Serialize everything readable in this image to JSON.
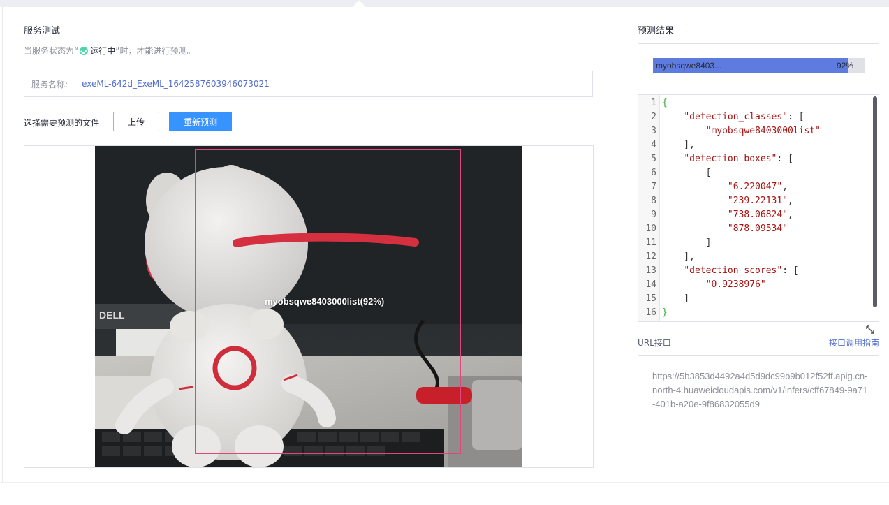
{
  "service_test": {
    "title": "服务测试",
    "status_note": {
      "prefix": "当服务状态为“",
      "status": "运行中",
      "suffix": "”时，才能进行预测。"
    },
    "service_name_label": "服务名称:",
    "service_name_value": "exeML-642d_ExeML_1642587603946073021",
    "select_file_label": "选择需要预测的文件",
    "upload_button": "上传",
    "repredict_button": "重新预测",
    "detection_label": "myobsqwe8403000list(92%)"
  },
  "prediction": {
    "title": "预测结果",
    "bar": {
      "label": "myobsqwe8403...",
      "percent_text": "92%",
      "fraction": 0.92,
      "color": "#5e7ce0"
    },
    "code_lines": [
      "{",
      "    \"detection_classes\": [",
      "        \"myobsqwe8403000list\"",
      "    ],",
      "    \"detection_boxes\": [",
      "        [",
      "            \"6.220047\",",
      "            \"239.22131\",",
      "            \"738.06824\",",
      "            \"878.09534\"",
      "        ]",
      "    ],",
      "    \"detection_scores\": [",
      "        \"0.9238976\"",
      "    ]",
      "}"
    ]
  },
  "url_section": {
    "label": "URL接口",
    "guide_link": "接口调用指南",
    "url": "https://5b3853d4492a4d5d9dc99b9b012f52ff.apig.cn-north-4.huaweicloudapis.com/v1/infers/cff67849-9a71-401b-a20e-9f86832055d9"
  },
  "colors": {
    "accent": "#3793ff",
    "link": "#526ecc",
    "status_ok": "#50d4ab",
    "bbox": "#e0467c"
  }
}
